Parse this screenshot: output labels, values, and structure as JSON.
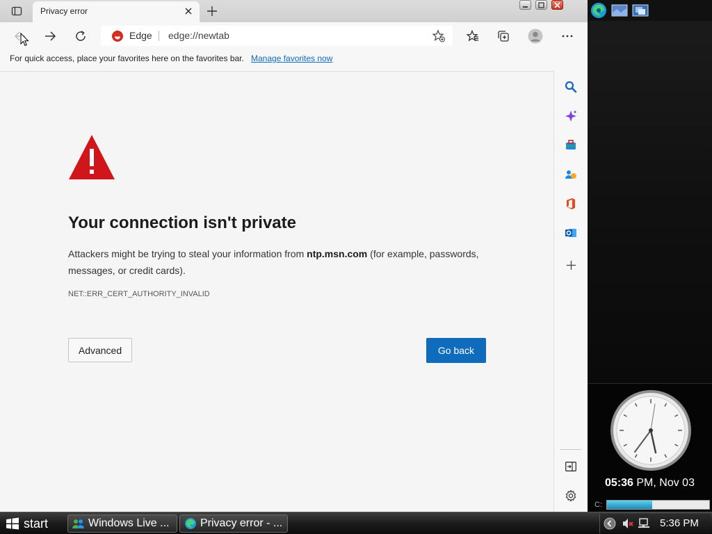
{
  "browser": {
    "tab_title": "Privacy error",
    "address": {
      "brand": "Edge",
      "url": "edge://newtab"
    },
    "favorites_bar": {
      "message": "For quick access, place your favorites here on the favorites bar.",
      "link": "Manage favorites now"
    }
  },
  "error_page": {
    "title": "Your connection isn't private",
    "body_before": "Attackers might be trying to steal your information from ",
    "domain": "ntp.msn.com",
    "body_after": " (for example, passwords, messages, or credit cards).",
    "code": "NET::ERR_CERT_AUTHORITY_INVALID",
    "advanced_label": "Advanced",
    "goback_label": "Go back",
    "accent_color": "#0f6cbd",
    "warning_color": "#d0161a"
  },
  "sidebar": {
    "items": [
      "search-icon",
      "copilot-icon",
      "tools-icon",
      "games-icon",
      "office-icon",
      "outlook-icon",
      "add-icon"
    ],
    "bottom": [
      "split-screen-icon",
      "settings-icon"
    ]
  },
  "desktop": {
    "clock_time": "05:36",
    "clock_suffix": " PM, Nov 03",
    "drive_label": "C:",
    "drive_used": 0.44
  },
  "taskbar": {
    "start_label": "start",
    "tasks": [
      "Windows Live ...",
      "Privacy error - ..."
    ],
    "time": "5:36 PM"
  }
}
